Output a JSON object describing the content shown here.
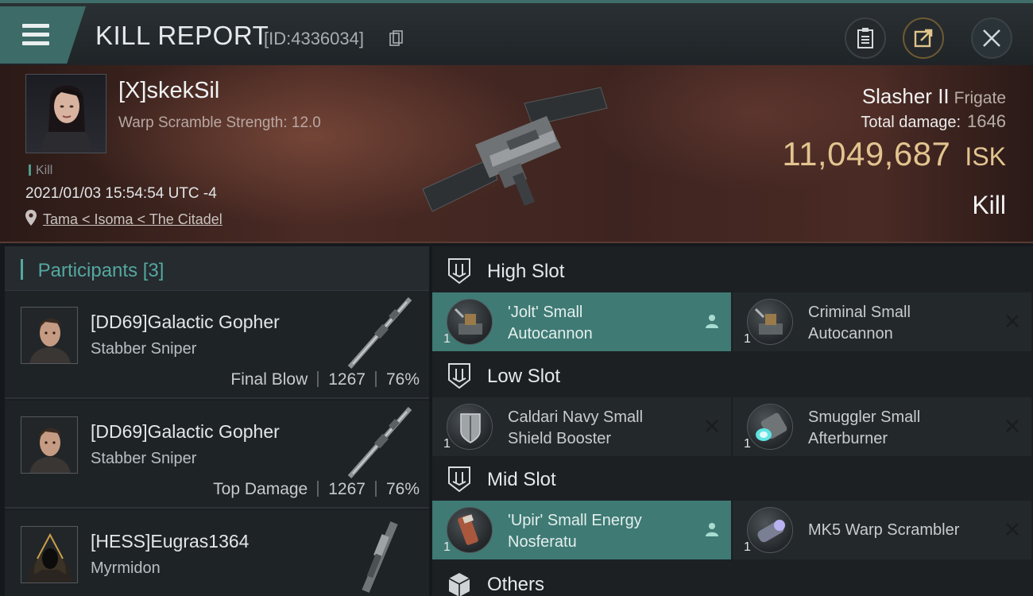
{
  "header": {
    "title": "KILL REPORT",
    "report_id": "[ID:4336034]",
    "buttons": {
      "clipboard": "clipboard-icon",
      "share": "share-icon",
      "close": "close-icon"
    }
  },
  "victim": {
    "name": "[X]skekSil",
    "warp_scramble": "Warp Scramble Strength: 12.0",
    "tag": "Kill",
    "timestamp": "2021/01/03 15:54:54 UTC -4",
    "location": "Tama < Isoma < The Citadel",
    "ship_name": "Slasher II",
    "ship_class": "Frigate",
    "total_damage_label": "Total damage:",
    "total_damage": "1646",
    "isk_value": "11,049,687",
    "isk_unit": "ISK",
    "result": "Kill"
  },
  "participants": {
    "heading": "Participants",
    "count": "[3]",
    "rows": [
      {
        "name": "[DD69]Galactic Gopher",
        "ship": "Stabber Sniper",
        "badge": "Final Blow",
        "damage": "1267",
        "percent": "76%"
      },
      {
        "name": "[DD69]Galactic Gopher",
        "ship": "Stabber Sniper",
        "badge": "Top Damage",
        "damage": "1267",
        "percent": "76%"
      },
      {
        "name": "[HESS]Eugras1364",
        "ship": "Myrmidon"
      }
    ]
  },
  "fitting": {
    "high_slot": {
      "title": "High Slot",
      "modules": [
        {
          "qty": "1",
          "name_line1": "'Jolt' Small",
          "name_line2": "Autocannon",
          "action": "pilot-icon",
          "highlight": true
        },
        {
          "qty": "1",
          "name_line1": "Criminal Small",
          "name_line2": "Autocannon",
          "action": "destroyed-x-icon",
          "highlight": false
        }
      ]
    },
    "low_slot": {
      "title": "Low Slot",
      "modules": [
        {
          "qty": "1",
          "name_line1": "Caldari Navy Small",
          "name_line2": "Shield Booster",
          "action": "destroyed-x-icon",
          "highlight": false
        },
        {
          "qty": "1",
          "name_line1": "Smuggler Small",
          "name_line2": "Afterburner",
          "action": "destroyed-x-icon",
          "highlight": false
        }
      ]
    },
    "mid_slot": {
      "title": "Mid Slot",
      "modules": [
        {
          "qty": "1",
          "name_line1": "'Upir' Small Energy",
          "name_line2": "Nosferatu",
          "action": "pilot-icon",
          "highlight": true
        },
        {
          "qty": "1",
          "name_line1": "MK5 Warp Scrambler",
          "name_line2": "",
          "action": "destroyed-x-icon",
          "highlight": false
        }
      ]
    },
    "others": {
      "title": "Others"
    }
  },
  "colors": {
    "accent_teal": "#3f7a74",
    "isk_gold": "#e2c48f",
    "banner_red": "#4a2a24"
  }
}
